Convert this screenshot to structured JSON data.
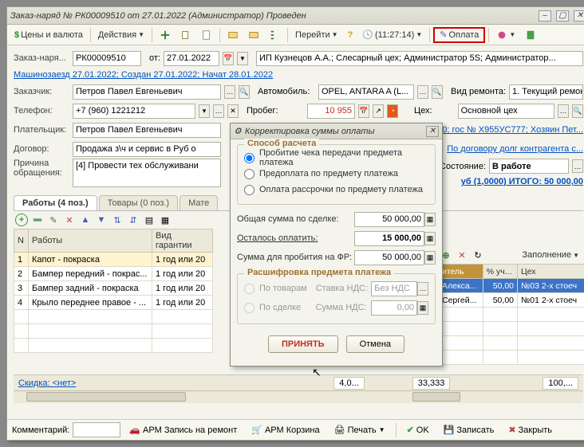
{
  "title": "Заказ-наряд № РК00009510 от 27.01.2022 (Администратор) Проведен",
  "toolbar": {
    "price": "Цены и валюта",
    "actions": "Действия",
    "goto": "Перейти",
    "time": "(11:27:14)",
    "payment": "Оплата"
  },
  "header": {
    "doc_label": "Заказ-наря...",
    "doc_num": "РК00009510",
    "from": "от:",
    "date": "27.01.2022",
    "org": "ИП Кузнецов А.А.; Слесарный цех; Администратор 5S; Администратор..."
  },
  "statusline": "Машинозаезд 27.01.2022; Создан 27.01.2022; Начат 28.01.2022",
  "fields": {
    "customer_label": "Заказчик:",
    "customer": "Петров Павел Евгеньевич",
    "car_label": "Автомобиль:",
    "car": "OPEL, ANTARA A (L...",
    "repair_type_label": "Вид ремонта:",
    "repair_type": "1. Текущий ремон",
    "phone_label": "Телефон:",
    "phone": "+7 (960) 1221212",
    "mileage_label": "Пробег:",
    "mileage": "10 955",
    "shop_label": "Цех:",
    "shop": "Основной цех",
    "payer_label": "Плательщик:",
    "payer": "Петров Павел Евгеньевич",
    "vehicle_link": "0; гос № X955УС777; Хозяин Пет...",
    "contract_label": "Договор:",
    "contract": "Продажа з\\ч и сервис в Руб о",
    "contract_link": "По договору долг контрагента с...",
    "reason_label": "Причина обращения:",
    "reason": "[4] Провести тех обслуживани",
    "state_label": "Состояние:",
    "state": "В работе",
    "total_link": "уб (1,0000) ИТОГО: 50 000,00"
  },
  "tabs": {
    "works": "Работы (4 поз.)",
    "goods": "Товары (0 поз.)",
    "mat": "Мате"
  },
  "left_table": {
    "headers": {
      "n": "N",
      "work": "Работы",
      "warranty": "Вид гарантии"
    },
    "rows": [
      {
        "n": "1",
        "name": "Капот - покраска",
        "warranty": "1 год или 20"
      },
      {
        "n": "2",
        "name": "Бампер передний - покрас...",
        "warranty": "1 год или 20"
      },
      {
        "n": "3",
        "name": "Бампер задний - покраска",
        "warranty": "1 год или 20"
      },
      {
        "n": "4",
        "name": "Крыло переднее правое - ...",
        "warranty": "1 год или 20"
      }
    ]
  },
  "right_panel": {
    "fill": "Заполнение",
    "headers": {
      "worker": "итель",
      "pct": "% уч...",
      "shop": "Цех"
    },
    "rows": [
      {
        "worker": "Алекса...",
        "pct": "50,00",
        "shop": "№03  2-х стоеч"
      },
      {
        "worker": "Сергей...",
        "pct": "50,00",
        "shop": "№01  2-х стоеч"
      }
    ]
  },
  "footer": {
    "discount": "Скидка: <нет>",
    "v1": "4,0...",
    "v2": "33,333",
    "v3": "100,..."
  },
  "actionbar": {
    "comment": "Комментарий:",
    "arm1": "АРМ Запись на ремонт",
    "arm2": "АРМ Корзина",
    "print": "Печать",
    "ok": "OK",
    "save": "Записать",
    "close": "Закрыть"
  },
  "dialog": {
    "title": "Корректировка суммы оплаты",
    "method_legend": "Способ расчета",
    "opt1": "Пробитие чека передачи предмета платежа",
    "opt2": "Предоплата по предмету платежа",
    "opt3": "Оплата рассрочки по предмету платежа",
    "total_label": "Общая сумма по сделке:",
    "total": "50 000,00",
    "left_label": "Осталось оплатить:",
    "left": "15 000,00",
    "fr_label": "Сумма для пробития на ФР:",
    "fr": "50 000,00",
    "breakdown_legend": "Расшифровка предмета платежа",
    "by_goods": "По товарам",
    "by_deal": "По сделке",
    "vat_rate_label": "Ставка НДС:",
    "vat_rate": "Без НДС",
    "vat_sum_label": "Сумма НДС:",
    "vat_sum": "0,00",
    "accept": "ПРИНЯТЬ",
    "cancel": "Отмена"
  }
}
